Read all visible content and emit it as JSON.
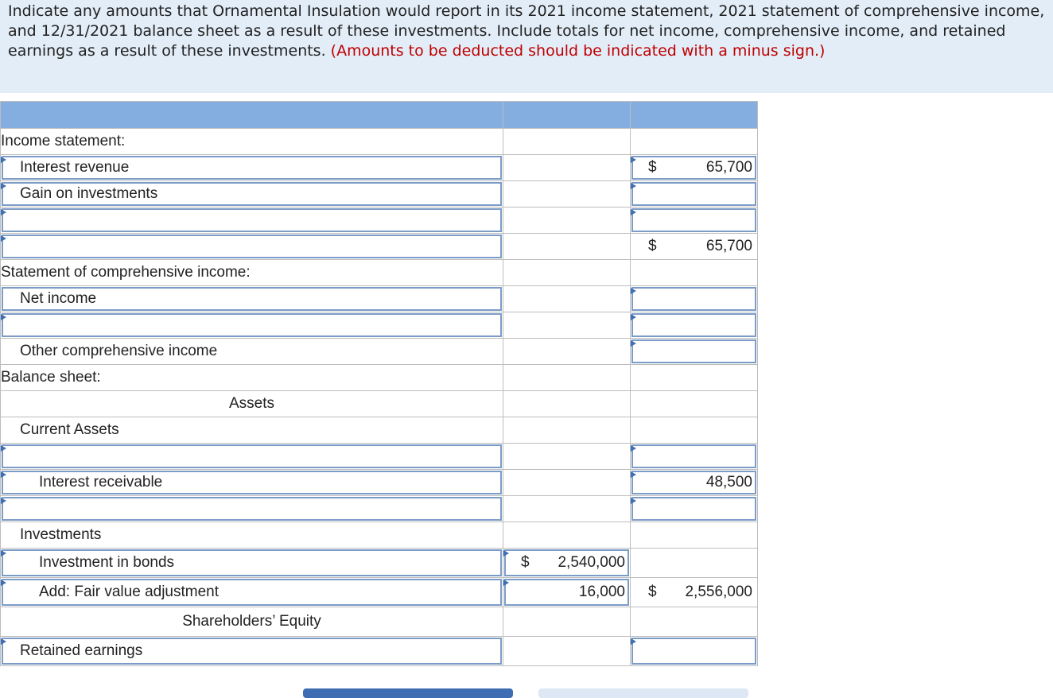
{
  "prompt": {
    "text": "Indicate any amounts that Ornamental Insulation would report in its 2021 income statement, 2021 statement of comprehensive income, and 12/31/2021 balance sheet as a result of these investments. Include totals for net income, comprehensive income, and retained earnings as a result of these investments.",
    "note": "(Amounts to be deducted should be indicated with a minus sign.)"
  },
  "rows": {
    "income_statement": "Income statement:",
    "interest_revenue": "Interest revenue",
    "interest_revenue_dollar": "$",
    "interest_revenue_amount": "65,700",
    "gain_on_investments": "Gain on investments",
    "total_dollar": "$",
    "total_amount": "65,700",
    "soci": "Statement of comprehensive income:",
    "net_income": "Net income",
    "oci": "Other comprehensive income",
    "balance_sheet": "Balance sheet:",
    "assets": "Assets",
    "current_assets": "Current Assets",
    "interest_receivable": "Interest receivable",
    "interest_receivable_amount": "48,500",
    "investments": "Investments",
    "investment_in_bonds": "Investment in bonds",
    "bonds_dollar": "$",
    "bonds_amount": "2,540,000",
    "fair_value_adj": "Add: Fair value adjustment",
    "fair_value_amount": "16,000",
    "inv_total_dollar": "$",
    "inv_total_amount": "2,556,000",
    "shareholders_equity": "Shareholders’ Equity",
    "retained_earnings": "Retained earnings"
  }
}
